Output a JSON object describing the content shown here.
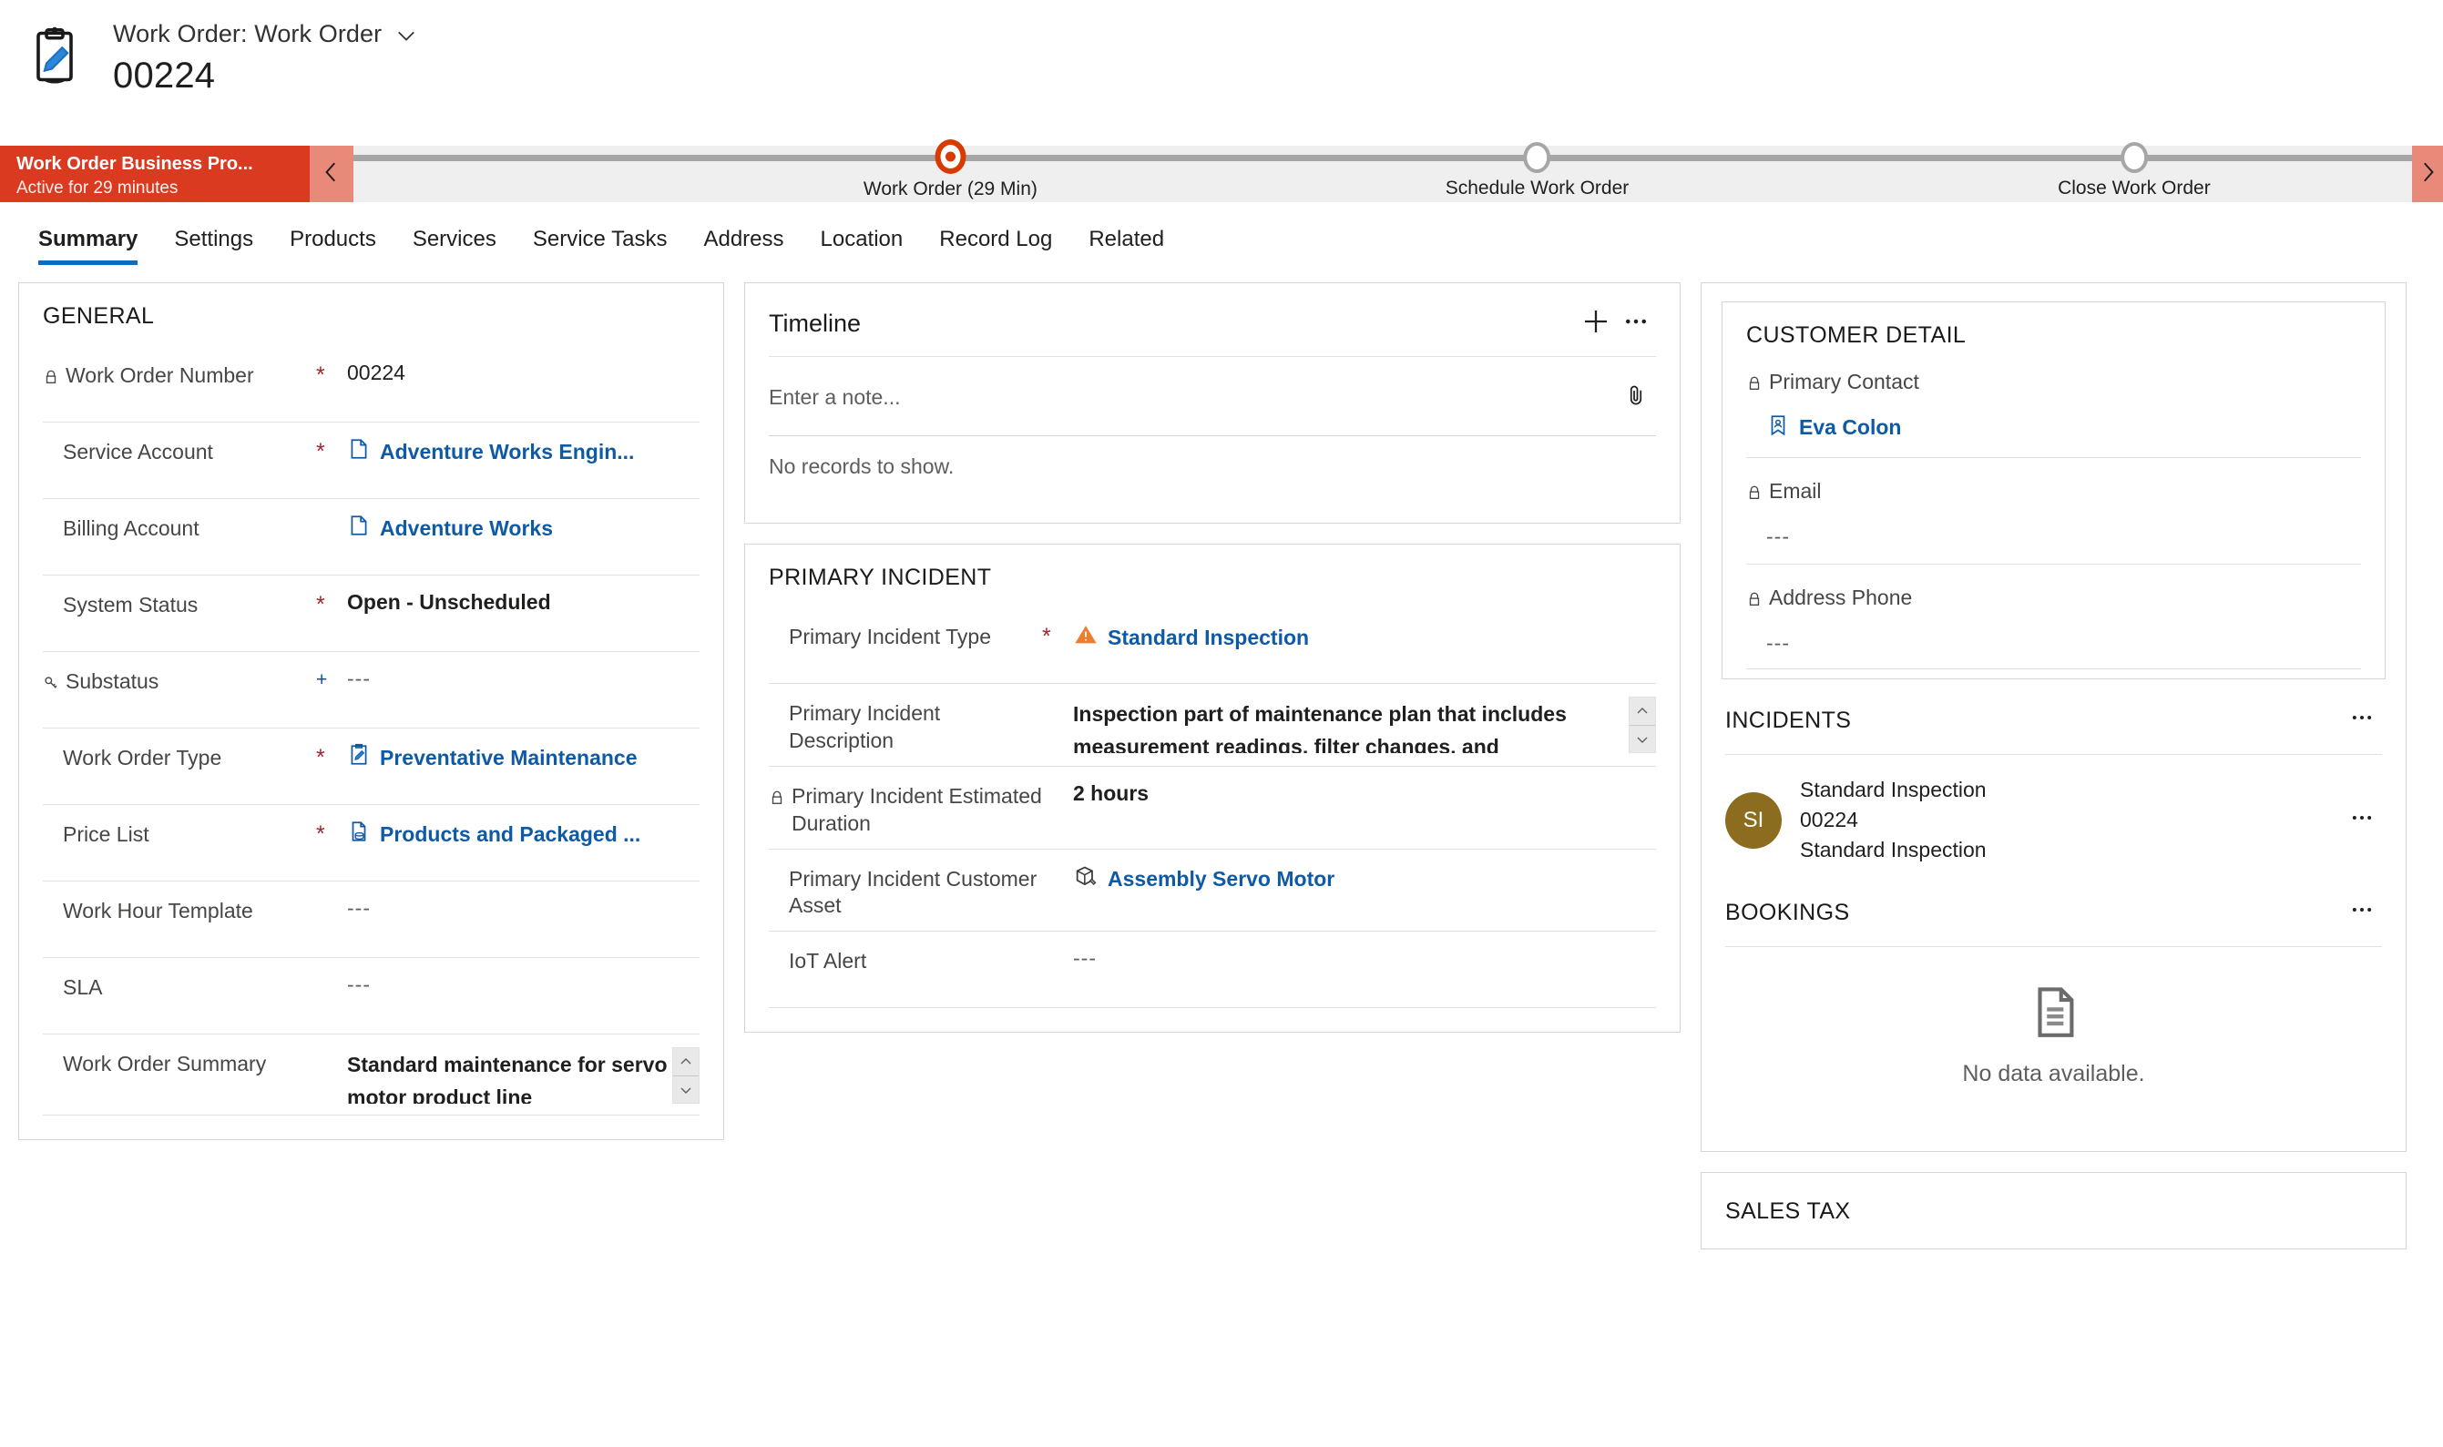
{
  "header": {
    "entity_breadcrumb": "Work Order: Work Order",
    "record_title": "00224",
    "record_icon": "clipboard-pen-icon",
    "chevron_icon": "chevron-down-icon"
  },
  "bpf": {
    "banner_title": "Work Order Business Pro...",
    "banner_subtitle": "Active for 29 minutes",
    "prev_icon": "chevron-left-icon",
    "next_icon": "chevron-right-icon",
    "active_color": "#d83b01",
    "banner_color": "#da3b20",
    "stages": [
      {
        "label": "Work Order  (29 Min)",
        "active": true,
        "pos": 29
      },
      {
        "label": "Schedule Work Order",
        "active": false,
        "pos": 57.5
      },
      {
        "label": "Close Work Order",
        "active": false,
        "pos": 86.5
      }
    ]
  },
  "tabs": [
    {
      "label": "Summary",
      "active": true
    },
    {
      "label": "Settings",
      "active": false
    },
    {
      "label": "Products",
      "active": false
    },
    {
      "label": "Services",
      "active": false
    },
    {
      "label": "Service Tasks",
      "active": false
    },
    {
      "label": "Address",
      "active": false
    },
    {
      "label": "Location",
      "active": false
    },
    {
      "label": "Record Log",
      "active": false
    },
    {
      "label": "Related",
      "active": false
    }
  ],
  "general": {
    "title": "GENERAL",
    "fields": [
      {
        "label": "Work Order Number",
        "lock": "lock-icon",
        "req": "*",
        "value": "00224",
        "type": "text"
      },
      {
        "label": "Service Account",
        "req": "*",
        "value": "Adventure Works Engin...",
        "type": "link",
        "icon": "account-record-icon"
      },
      {
        "label": "Billing Account",
        "req": "",
        "value": "Adventure Works",
        "type": "link",
        "icon": "account-record-icon"
      },
      {
        "label": "System Status",
        "req": "*",
        "value": "Open - Unscheduled",
        "type": "strong"
      },
      {
        "label": "Substatus",
        "lock": "key-icon",
        "req": "+",
        "value": "---",
        "type": "empty"
      },
      {
        "label": "Work Order Type",
        "req": "*",
        "value": "Preventative Maintenance",
        "type": "link",
        "icon": "clipboard-pen-icon"
      },
      {
        "label": "Price List",
        "req": "*",
        "value": "Products and Packaged ...",
        "type": "link",
        "icon": "pricelist-icon"
      },
      {
        "label": "Work Hour Template",
        "req": "",
        "value": "---",
        "type": "empty"
      },
      {
        "label": "SLA",
        "req": "",
        "value": "---",
        "type": "empty"
      },
      {
        "label": "Work Order Summary",
        "req": "",
        "value": "Standard maintenance for servo motor product line",
        "type": "textarea"
      }
    ]
  },
  "timeline": {
    "title": "Timeline",
    "add_icon": "plus-icon",
    "more_icon": "ellipsis-icon",
    "note_placeholder": "Enter a note...",
    "attach_icon": "paperclip-icon",
    "empty_text": "No records to show."
  },
  "primary_incident": {
    "title": "PRIMARY INCIDENT",
    "fields": [
      {
        "label": "Primary Incident Type",
        "req": "*",
        "value": "Standard Inspection",
        "type": "link",
        "icon": "warning-triangle-icon"
      },
      {
        "label": "Primary Incident Description",
        "req": "",
        "value": "Inspection part of maintenance plan that includes measurement readings, filter changes, and",
        "type": "textarea"
      },
      {
        "label": "Primary Incident Estimated Duration",
        "lock": "lock-icon",
        "req": "",
        "value": "2 hours",
        "type": "strong"
      },
      {
        "label": "Primary Incident Customer Asset",
        "req": "",
        "value": "Assembly Servo Motor",
        "type": "link",
        "icon": "asset-box-icon"
      },
      {
        "label": "IoT Alert",
        "req": "",
        "value": "---",
        "type": "empty"
      }
    ]
  },
  "customer_detail": {
    "title": "CUSTOMER DETAIL",
    "fields": [
      {
        "label": "Primary Contact",
        "lock": "lock-icon",
        "value": "Eva Colon",
        "type": "link",
        "icon": "contact-card-icon"
      },
      {
        "label": "Email",
        "lock": "lock-icon",
        "value": "---",
        "type": "empty"
      },
      {
        "label": "Address Phone",
        "lock": "lock-icon",
        "value": "---",
        "type": "empty"
      }
    ]
  },
  "incidents": {
    "title": "INCIDENTS",
    "more_icon": "ellipsis-icon",
    "items": [
      {
        "initials": "SI",
        "avatar_color": "#8c6d1f",
        "line1": "Standard Inspection",
        "line2": "00224",
        "line3": "Standard Inspection",
        "row_more_icon": "ellipsis-icon"
      }
    ]
  },
  "bookings": {
    "title": "BOOKINGS",
    "more_icon": "ellipsis-icon",
    "empty_icon": "document-lines-icon",
    "empty_text": "No data available."
  },
  "sales_tax": {
    "title": "SALES TAX"
  }
}
